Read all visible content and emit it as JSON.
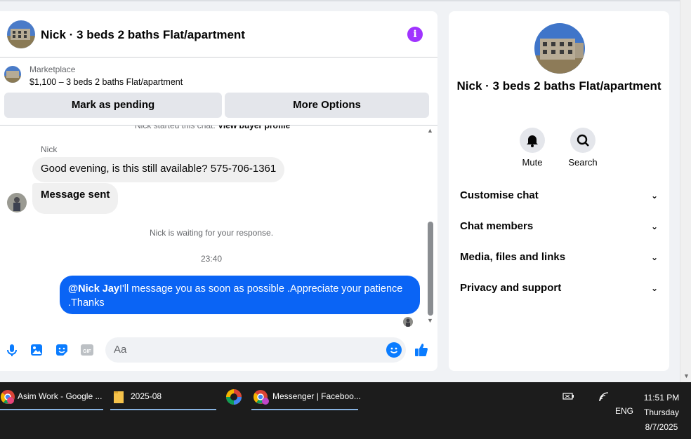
{
  "chat": {
    "title": "Nick · 3 beds 2 baths Flat/apartment",
    "info_icon": "i",
    "marketplace": {
      "label": "Marketplace",
      "listing": "$1,100 – 3 beds 2 baths Flat/apartment",
      "mark_pending": "Mark as pending",
      "more_options": "More Options"
    },
    "started_text": "Nick started this chat.",
    "view_profile": "View buyer profile",
    "sender_name": "Nick",
    "incoming": [
      "Good evening, is this still available? 575-706-1361",
      "Message sent"
    ],
    "waiting_text": "Nick is waiting for your response.",
    "timestamp": "23:40",
    "outgoing": {
      "mention": "@Nick Jay",
      "text": "I'll message you as soon as possible .Appreciate your patience .Thanks"
    },
    "composer_placeholder": "Aa",
    "accent_color": "#0a64f5"
  },
  "side": {
    "title": "Nick · 3 beds 2 baths Flat/apartment",
    "actions": [
      "Mute",
      "Search"
    ],
    "menu": [
      "Customise chat",
      "Chat members",
      "Media, files and links",
      "Privacy and support"
    ]
  },
  "taskbar": {
    "items": [
      {
        "label": "Asim Work - Google ...",
        "icon": "chrome-icon"
      },
      {
        "label": "2025-08",
        "icon": "folder-icon"
      },
      {
        "label": "",
        "icon": "photos-icon"
      },
      {
        "label": "Messenger | Faceboo...",
        "icon": "chrome-icon"
      }
    ],
    "lang": "ENG",
    "time": "11:51 PM",
    "day": "Thursday",
    "date": "8/7/2025"
  }
}
